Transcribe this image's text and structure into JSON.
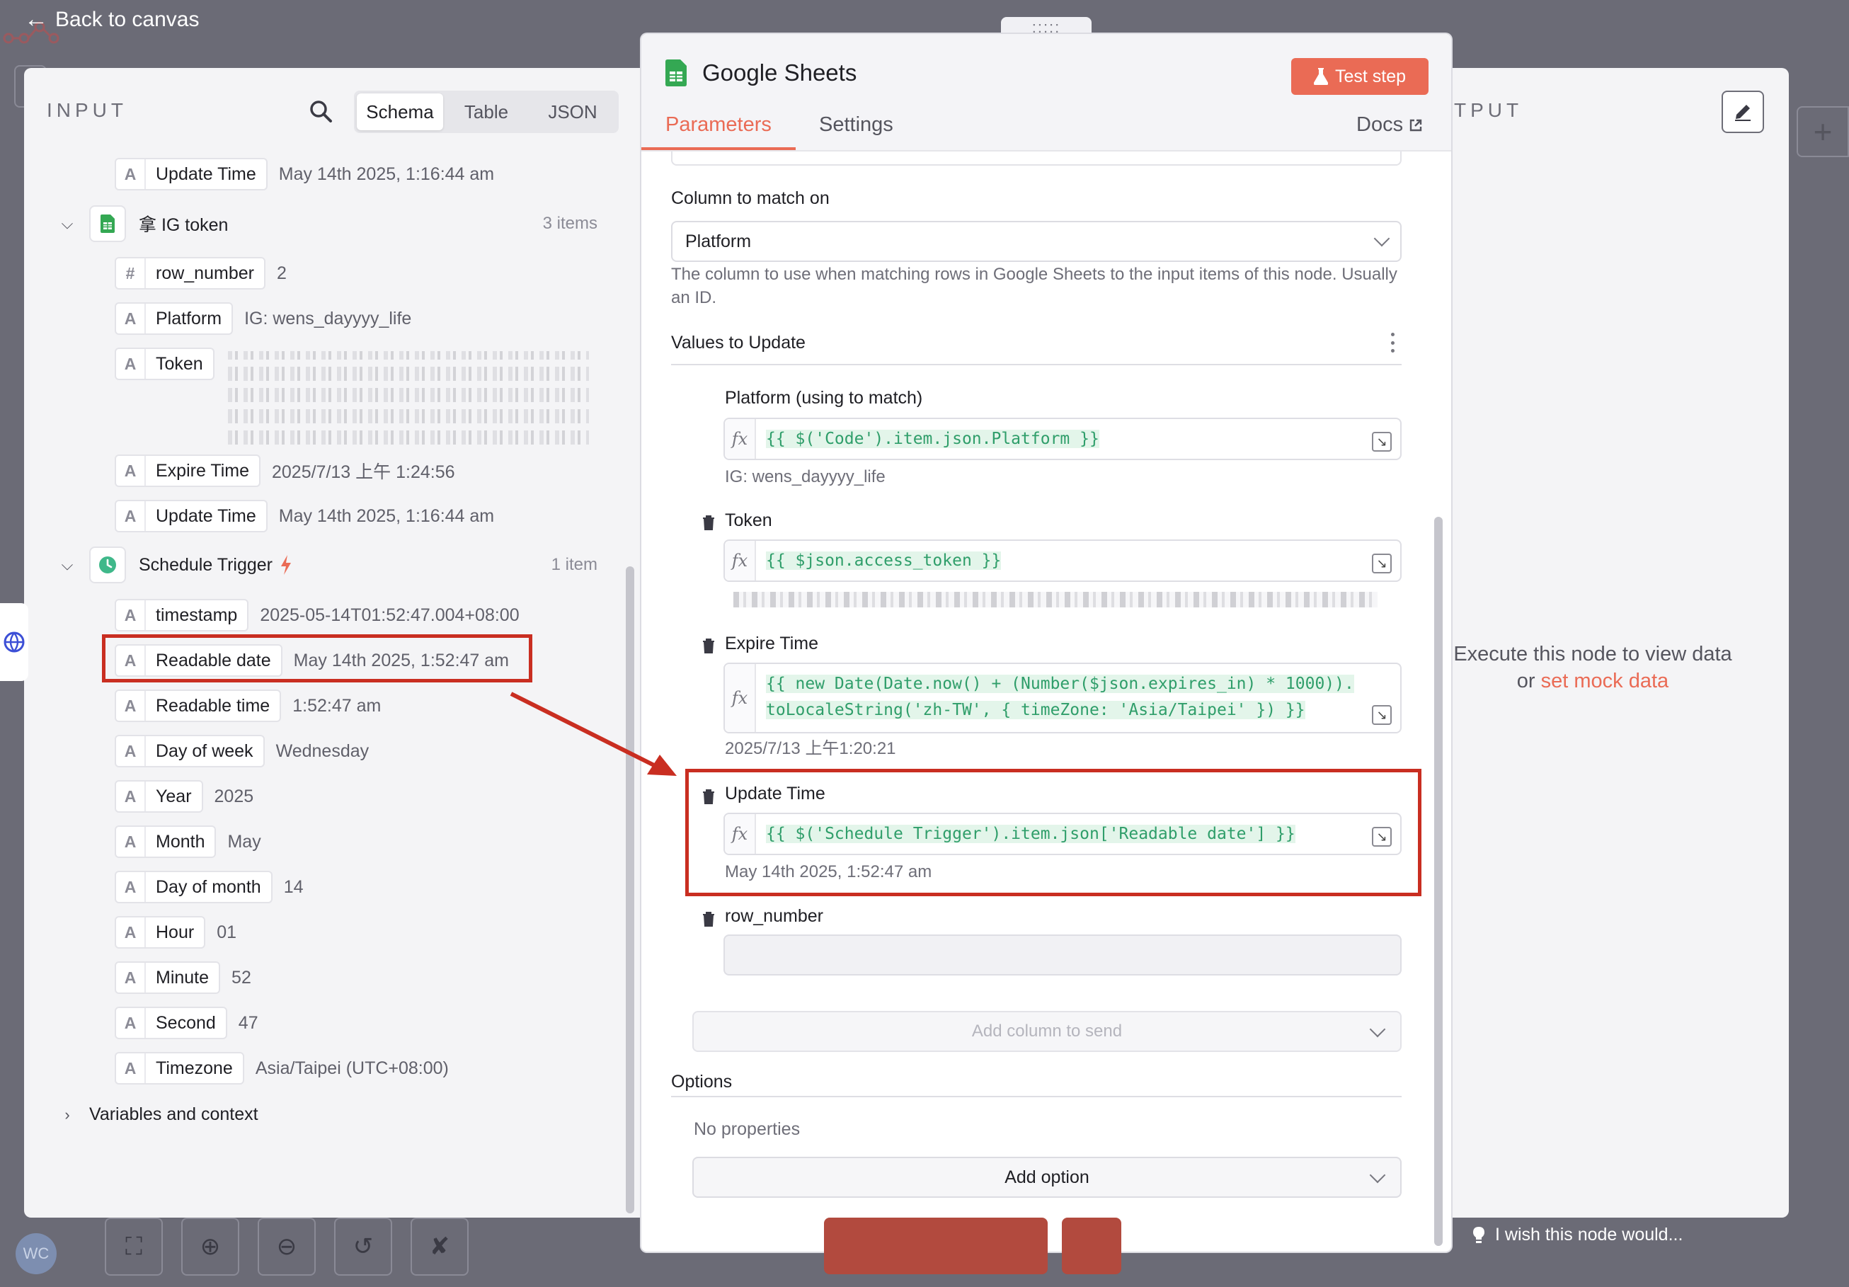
{
  "canvas": {
    "back_label": "Back to canvas",
    "avatar_initials": "WC",
    "toolbar": [
      "fit-view-icon",
      "zoom-in-icon",
      "zoom-out-icon",
      "undo-icon",
      "clear-execution-icon"
    ]
  },
  "input": {
    "title": "INPUT",
    "tabs": [
      "Schema",
      "Table",
      "JSON"
    ],
    "active_tab": "Schema",
    "top_row": {
      "type": "A",
      "name": "Update Time",
      "value": "May 14th 2025, 1:16:44 am"
    },
    "ig_group": {
      "name": "拿 IG token",
      "count": "3 items",
      "fields": [
        {
          "type": "#",
          "name": "row_number",
          "value": "2"
        },
        {
          "type": "A",
          "name": "Platform",
          "value": "IG: wens_dayyyy_life"
        },
        {
          "type": "A",
          "name": "Token",
          "value": ""
        },
        {
          "type": "A",
          "name": "Expire Time",
          "value": "2025/7/13 上午 1:24:56"
        },
        {
          "type": "A",
          "name": "Update Time",
          "value": "May 14th 2025, 1:16:44 am"
        }
      ]
    },
    "schedule_group": {
      "name": "Schedule Trigger",
      "count": "1 item",
      "fields": [
        {
          "type": "A",
          "name": "timestamp",
          "value": "2025-05-14T01:52:47.004+08:00"
        },
        {
          "type": "A",
          "name": "Readable date",
          "value": "May 14th 2025, 1:52:47 am"
        },
        {
          "type": "A",
          "name": "Readable time",
          "value": "1:52:47 am"
        },
        {
          "type": "A",
          "name": "Day of week",
          "value": "Wednesday"
        },
        {
          "type": "A",
          "name": "Year",
          "value": "2025"
        },
        {
          "type": "A",
          "name": "Month",
          "value": "May"
        },
        {
          "type": "A",
          "name": "Day of month",
          "value": "14"
        },
        {
          "type": "A",
          "name": "Hour",
          "value": "01"
        },
        {
          "type": "A",
          "name": "Minute",
          "value": "52"
        },
        {
          "type": "A",
          "name": "Second",
          "value": "47"
        },
        {
          "type": "A",
          "name": "Timezone",
          "value": "Asia/Taipei (UTC+08:00)"
        }
      ]
    },
    "variables_label": "Variables and context"
  },
  "node": {
    "title": "Google Sheets",
    "test_label": "Test step",
    "tabs": [
      "Parameters",
      "Settings"
    ],
    "active_tab": "Parameters",
    "docs_label": "Docs",
    "handle": ":::::",
    "column_match": {
      "label": "Column to match on",
      "value": "Platform",
      "hint": "The column to use when matching rows in Google Sheets to the input items of this node. Usually an ID."
    },
    "values_label": "Values to Update",
    "fields": [
      {
        "label": "Platform (using to match)",
        "code": "{{ $('Code').item.json.Platform }}",
        "result": "IG: wens_dayyyy_life"
      },
      {
        "label": "Token",
        "code": "{{ $json.access_token }}",
        "result": ""
      },
      {
        "label": "Expire Time",
        "code": "{{ new Date(Date.now() + (Number($json.expires_in) * 1000)).toLocaleString('zh-TW', { timeZone: 'Asia/Taipei' }) }}",
        "result": "2025/7/13 上午1:20:21"
      },
      {
        "label": "Update Time",
        "code": "{{ $('Schedule Trigger').item.json['Readable date'] }}",
        "result": "May 14th 2025, 1:52:47 am"
      },
      {
        "label": "row_number",
        "code": "",
        "result": ""
      }
    ],
    "add_column_label": "Add column to send",
    "options_label": "Options",
    "no_properties": "No properties",
    "add_option_label": "Add option"
  },
  "output": {
    "title": "TPUT",
    "message": "Execute this node to view data",
    "or_label": "or",
    "mock_link": "set mock data",
    "wish_label": "I wish this node would..."
  },
  "colors": {
    "accent": "#ea6b55",
    "highlight": "#c92e21",
    "expression": "#2f9e6a"
  }
}
